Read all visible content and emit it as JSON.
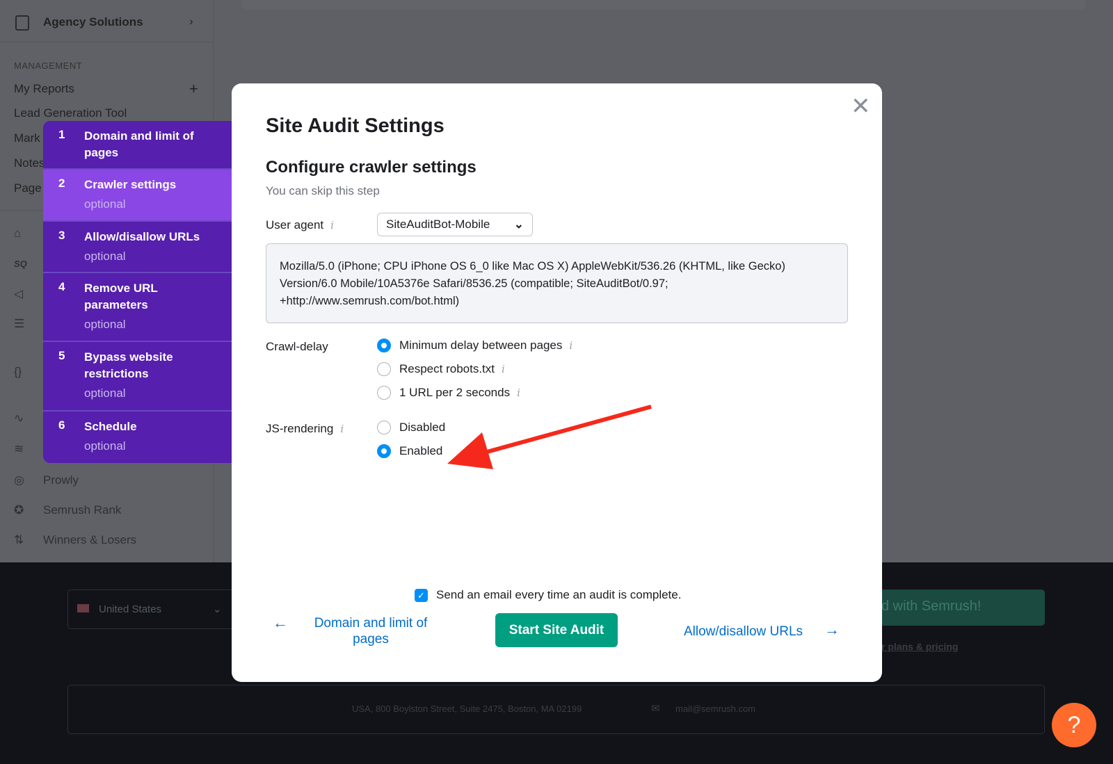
{
  "sidebar": {
    "agency": "Agency Solutions",
    "management": "MANAGEMENT",
    "items": [
      "My Reports",
      "Lead Generation Tool",
      "Mark",
      "Notes",
      "Page"
    ],
    "lower": [
      "Prowly",
      "Semrush Rank",
      "Winners & Losers"
    ]
  },
  "steps": [
    {
      "n": "1",
      "title": "Domain and limit of pages",
      "sub": ""
    },
    {
      "n": "2",
      "title": "Crawler settings",
      "sub": "optional"
    },
    {
      "n": "3",
      "title": "Allow/disallow URLs",
      "sub": "optional"
    },
    {
      "n": "4",
      "title": "Remove URL parameters",
      "sub": "optional"
    },
    {
      "n": "5",
      "title": "Bypass website restrictions",
      "sub": "optional"
    },
    {
      "n": "6",
      "title": "Schedule",
      "sub": "optional"
    }
  ],
  "modal": {
    "title": "Site Audit Settings",
    "subtitle": "Configure crawler settings",
    "hint": "You can skip this step",
    "user_agent_label": "User agent",
    "user_agent_value": "SiteAuditBot-Mobile",
    "ua_string": "Mozilla/5.0 (iPhone; CPU iPhone OS 6_0 like Mac OS X) AppleWebKit/536.26 (KHTML, like Gecko) Version/6.0 Mobile/10A5376e Safari/8536.25 (compatible; SiteAuditBot/0.97; +http://www.semrush.com/bot.html)",
    "crawl_delay_label": "Crawl-delay",
    "crawl_options": [
      "Minimum delay between pages",
      "Respect robots.txt",
      "1 URL per 2 seconds"
    ],
    "crawl_selected": 0,
    "js_label": "JS-rendering",
    "js_options": [
      "Disabled",
      "Enabled"
    ],
    "js_selected": 1,
    "email_label": "Send an email every time an audit is complete.",
    "email_checked": true,
    "prev": "Domain and limit of pages",
    "start": "Start Site Audit",
    "next": "Allow/disallow URLs"
  },
  "background": {
    "country": "United States",
    "cta": "d with Semrush!",
    "plans": "r plans & pricing",
    "address": "USA, 800 Boylston Street, Suite 2475, Boston, MA 02199",
    "email": "mail@semrush.com",
    "help": "?"
  },
  "colors": {
    "accent": "#8a47e5",
    "steps_bg": "#561fad",
    "primary": "#009f81",
    "link": "#006dca",
    "radio": "#008ff8",
    "arrow": "#f5291b",
    "help": "#ff6b2c"
  }
}
